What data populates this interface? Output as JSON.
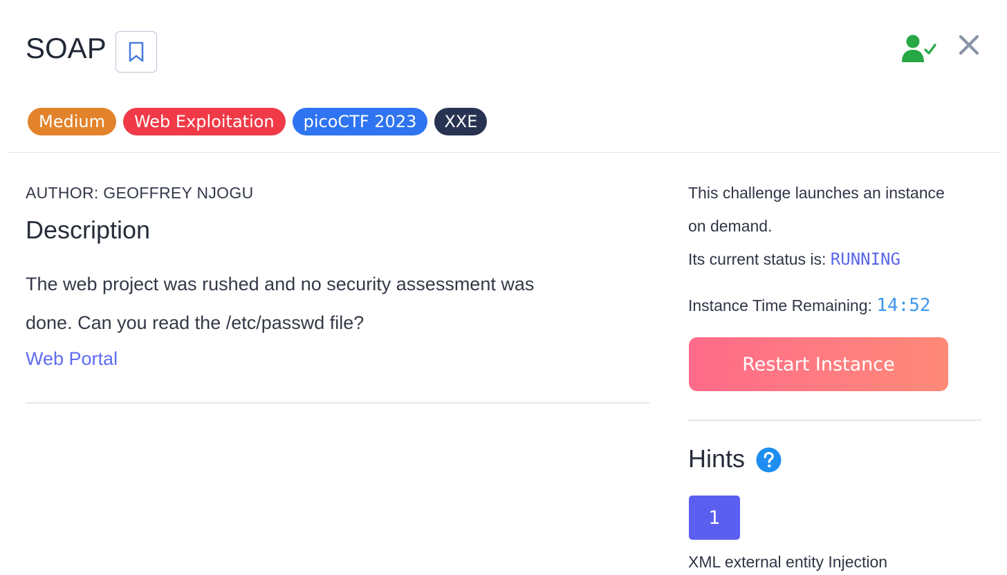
{
  "header": {
    "title": "SOAP",
    "bookmark_icon": "bookmark-icon",
    "user_status_icon": "user-check-icon",
    "close_icon": "close-icon"
  },
  "tags": [
    {
      "label": "Medium",
      "color": "#e2832b"
    },
    {
      "label": "Web Exploitation",
      "color": "#f03a47"
    },
    {
      "label": "picoCTF 2023",
      "color": "#2f74f0"
    },
    {
      "label": "XXE",
      "color": "#283352"
    }
  ],
  "main": {
    "author": "AUTHOR: GEOFFREY NJOGU",
    "description_heading": "Description",
    "description_line1": "The web project was rushed and no security assessment was",
    "description_line2": "done. Can you read the /etc/passwd file?",
    "link_label": "Web Portal"
  },
  "instance": {
    "info_line1": "This challenge launches an instance",
    "info_line2": "on demand.",
    "status_prefix": "Its current status is:",
    "status_value": "RUNNING",
    "time_prefix": "Instance Time Remaining:",
    "time_value": "14:52",
    "restart_label": "Restart Instance"
  },
  "hints": {
    "heading": "Hints",
    "help_icon": "question-circle-icon",
    "tabs": [
      {
        "label": "1"
      }
    ],
    "text": "XML external entity Injection"
  },
  "colors": {
    "accent": "#5b5ff0",
    "status_running": "#5a67e8",
    "timer": "#3d97ef",
    "user_check": "#27a745"
  }
}
